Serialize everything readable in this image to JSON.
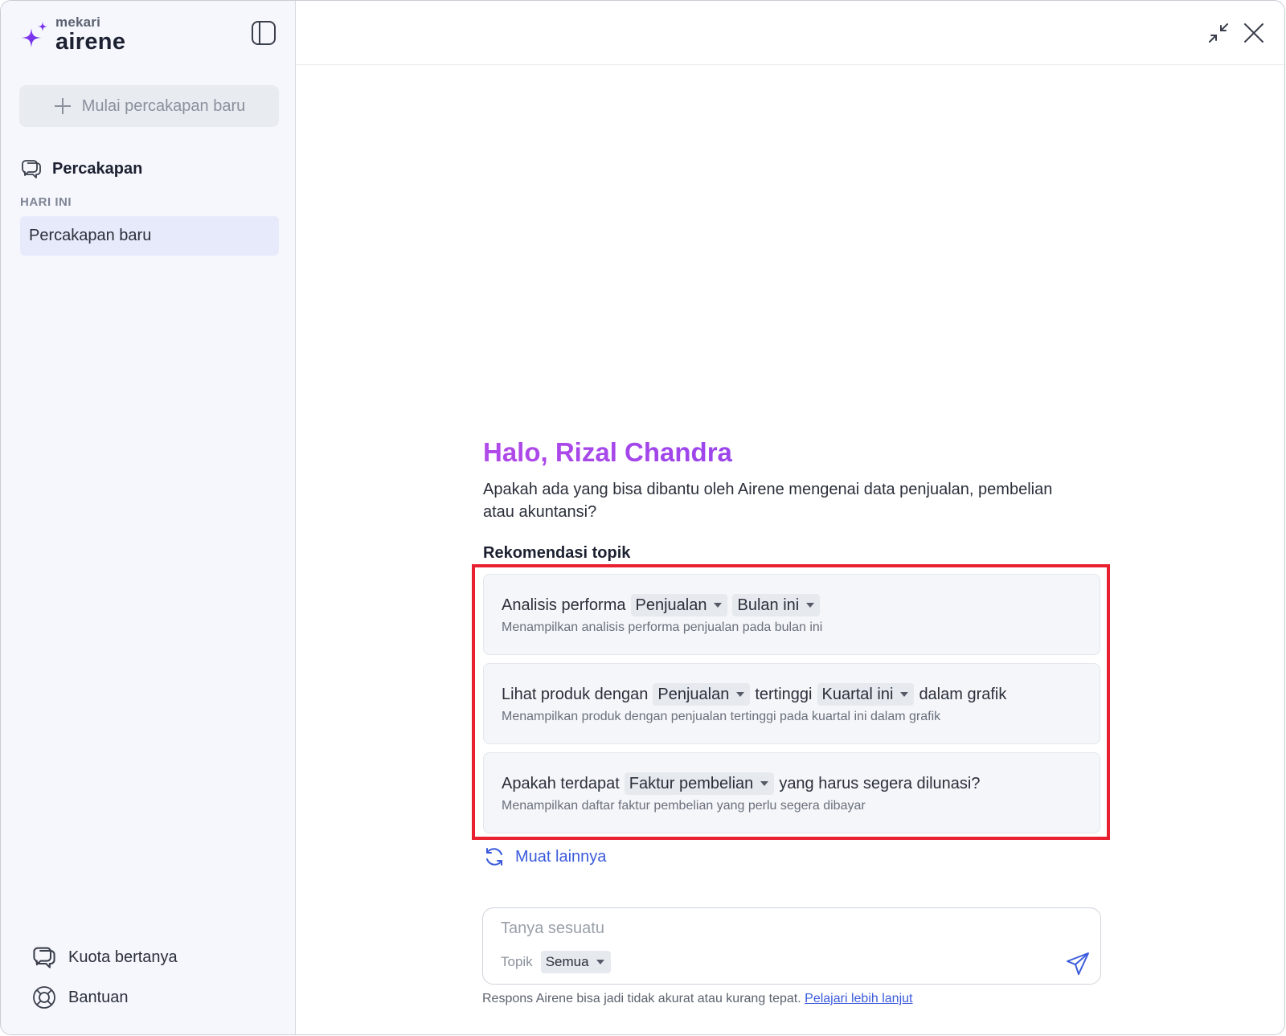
{
  "brand": {
    "small": "mekari",
    "name": "airene"
  },
  "sidebar": {
    "new_chat_label": "Mulai percakapan baru",
    "conversations_title": "Percakapan",
    "group_label": "HARI INI",
    "items": [
      {
        "label": "Percakapan baru"
      }
    ],
    "footer": {
      "quota_label": "Kuota bertanya",
      "help_label": "Bantuan"
    }
  },
  "main": {
    "greeting": "Halo, Rizal Chandra",
    "subtitle": "Apakah ada yang bisa dibantu oleh Airene mengenai data penjualan, pembelian atau akuntansi?",
    "recommend_title": "Rekomendasi topik",
    "cards": [
      {
        "text1": "Analisis performa",
        "chip1": "Penjualan",
        "chip2": "Bulan ini",
        "desc": "Menampilkan analisis performa penjualan pada bulan ini"
      },
      {
        "text1": "Lihat produk dengan",
        "chip1": "Penjualan",
        "text2": "tertinggi",
        "chip2": "Kuartal ini",
        "text3": "dalam grafik",
        "desc": "Menampilkan produk dengan penjualan tertinggi pada kuartal ini dalam grafik"
      },
      {
        "text1": "Apakah terdapat",
        "chip1": "Faktur pembelian",
        "text2": "yang harus segera dilunasi?",
        "desc": "Menampilkan daftar faktur pembelian yang perlu segera dibayar"
      }
    ],
    "load_more": "Muat lainnya",
    "input": {
      "placeholder": "Tanya sesuatu",
      "topic_label": "Topik",
      "topic_value": "Semua"
    },
    "disclaimer": "Respons Airene bisa jadi tidak akurat atau kurang tepat.",
    "disclaimer_link": "Pelajari lebih lanjut"
  },
  "colors": {
    "accent": "#7b3df0",
    "link": "#3b5bdb",
    "highlight": "#e8202f"
  },
  "icons": [
    "sparkle-logo-icon",
    "sidebar-toggle-icon",
    "plus-icon",
    "chat-bubbles-icon",
    "minimize-icon",
    "close-icon",
    "refresh-icon",
    "send-icon",
    "lifebuoy-icon"
  ]
}
